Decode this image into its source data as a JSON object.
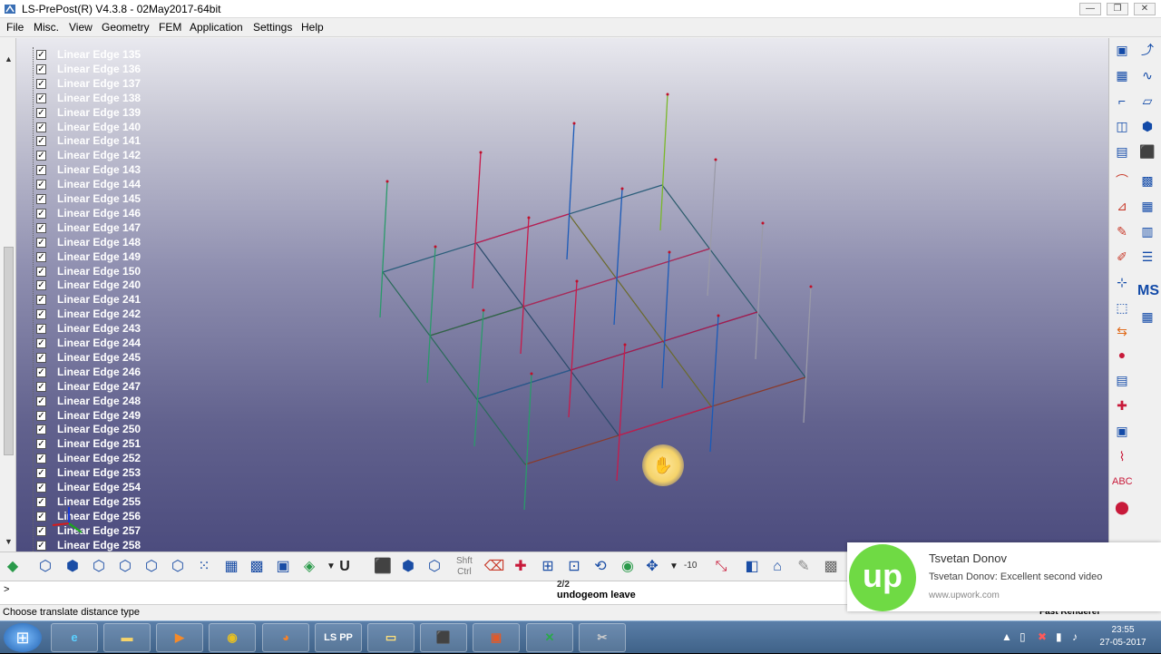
{
  "window": {
    "title": "LS-PrePost(R) V4.3.8 - 02May2017-64bit",
    "minimize": "—",
    "restore": "❐",
    "close": "✕"
  },
  "menu": [
    "File",
    "Misc.",
    "View",
    "Geometry",
    "FEM",
    "Application",
    "Settings",
    "Help"
  ],
  "tree": {
    "items": [
      "Linear Edge 135",
      "Linear Edge 136",
      "Linear Edge 137",
      "Linear Edge 138",
      "Linear Edge 139",
      "Linear Edge 140",
      "Linear Edge 141",
      "Linear Edge 142",
      "Linear Edge 143",
      "Linear Edge 144",
      "Linear Edge 145",
      "Linear Edge 146",
      "Linear Edge 147",
      "Linear Edge 148",
      "Linear Edge 149",
      "Linear Edge 150",
      "Linear Edge 240",
      "Linear Edge 241",
      "Linear Edge 242",
      "Linear Edge 243",
      "Linear Edge 244",
      "Linear Edge 245",
      "Linear Edge 246",
      "Linear Edge 247",
      "Linear Edge 248",
      "Linear Edge 249",
      "Linear Edge 250",
      "Linear Edge 251",
      "Linear Edge 252",
      "Linear Edge 253",
      "Linear Edge 254",
      "Linear Edge 255",
      "Linear Edge 256",
      "Linear Edge 257",
      "Linear Edge 258"
    ],
    "check_glyph": "✓"
  },
  "toolbar": {
    "shift_label": "Shft",
    "ctrl_label": "Ctrl",
    "value": "-10",
    "u_label": "U"
  },
  "command": {
    "prompt": ">",
    "line1": "2/2",
    "line2": "undogeom leave"
  },
  "status": {
    "text": "Choose translate distance type",
    "renderer": "Fast Renderer"
  },
  "right_toolbar": {
    "ms_label": "MS",
    "abc_label": "ABC"
  },
  "taskbar": {
    "lspp_label": "LS PP"
  },
  "clock": {
    "time": "23:55",
    "date": "27-05-2017"
  },
  "notification": {
    "title": "Tsvetan Donov",
    "message": "Tsvetan Donov: Excellent second video",
    "url": "www.upwork.com",
    "logo": "up"
  },
  "colors": {
    "bg_top": "#e9e9ef",
    "bg_bottom": "#4c4c7e",
    "accent": "#124aa8",
    "upwork": "#6fda44"
  }
}
